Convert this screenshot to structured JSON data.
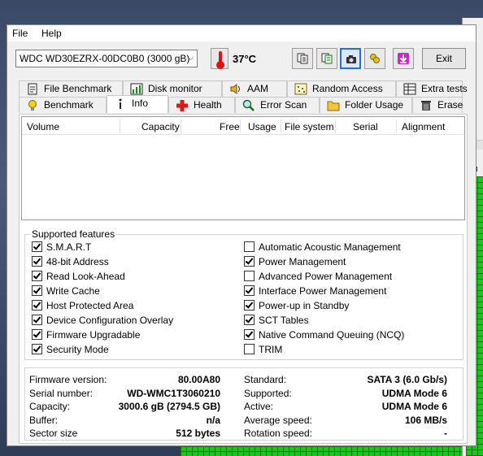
{
  "menu": {
    "file": "File",
    "help": "Help"
  },
  "toolbar": {
    "drive": "WDC WD30EZRX-00DC0B0 (3000 gB)",
    "temperature": "37°C",
    "exit_label": "Exit",
    "buttons": [
      "copy-text-icon",
      "copy-report-icon",
      "screenshot-icon",
      "options-icon",
      "save-icon"
    ]
  },
  "tabs_top": [
    "File Benchmark",
    "Disk monitor",
    "AAM",
    "Random Access",
    "Extra tests"
  ],
  "tabs_bottom": [
    "Benchmark",
    "Info",
    "Health",
    "Error Scan",
    "Folder Usage",
    "Erase"
  ],
  "volumes": {
    "columns": [
      "Volume",
      "Capacity",
      "Free",
      "Usage",
      "File system",
      "Serial",
      "Alignment"
    ]
  },
  "features": {
    "title": "Supported features",
    "left": [
      {
        "label": "S.M.A.R.T",
        "checked": true
      },
      {
        "label": "48-bit Address",
        "checked": true
      },
      {
        "label": "Read Look-Ahead",
        "checked": true
      },
      {
        "label": "Write Cache",
        "checked": true
      },
      {
        "label": "Host Protected Area",
        "checked": true
      },
      {
        "label": "Device Configuration Overlay",
        "checked": true
      },
      {
        "label": "Firmware Upgradable",
        "checked": true
      },
      {
        "label": "Security Mode",
        "checked": true
      }
    ],
    "right": [
      {
        "label": "Automatic Acoustic Management",
        "checked": false
      },
      {
        "label": "Power Management",
        "checked": true
      },
      {
        "label": "Advanced Power Management",
        "checked": false
      },
      {
        "label": "Interface Power Management",
        "checked": true
      },
      {
        "label": "Power-up in Standby",
        "checked": true
      },
      {
        "label": "SCT Tables",
        "checked": true
      },
      {
        "label": "Native Command Queuing (NCQ)",
        "checked": true
      },
      {
        "label": "TRIM",
        "checked": false
      }
    ]
  },
  "details": {
    "left": [
      {
        "key": "Firmware version:",
        "value": "80.00A80"
      },
      {
        "key": "Serial number:",
        "value": "WD-WMC1T3060210"
      },
      {
        "key": "Capacity:",
        "value": "3000.6 gB (2794.5 GB)"
      },
      {
        "key": "Buffer:",
        "value": "n/a"
      },
      {
        "key": "Sector size",
        "value": "512 bytes"
      }
    ],
    "right": [
      {
        "key": "Standard:",
        "value": "SATA 3 (6.0 Gb/s)"
      },
      {
        "key": "Supported:",
        "value": "UDMA Mode 6"
      },
      {
        "key": "Active:",
        "value": "UDMA Mode 6"
      },
      {
        "key": "Average speed:",
        "value": "106 MB/s"
      },
      {
        "key": "Rotation speed:",
        "value": "-"
      }
    ]
  }
}
